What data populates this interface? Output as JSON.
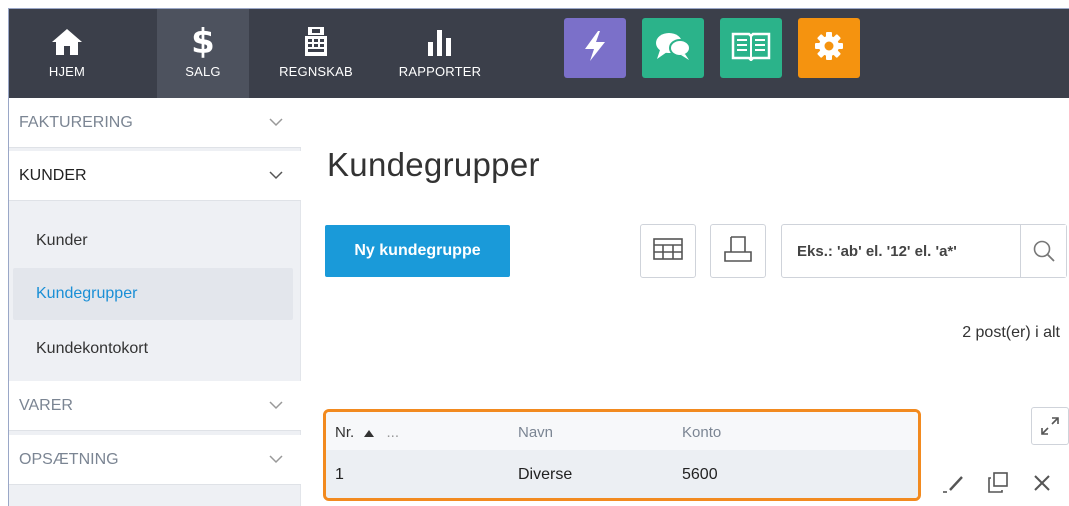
{
  "topnav": {
    "items": [
      {
        "id": "hjem",
        "label": "HJEM",
        "icon": "home-icon"
      },
      {
        "id": "salg",
        "label": "SALG",
        "icon": "dollar-icon",
        "glyph": "$",
        "active": true
      },
      {
        "id": "regnskab",
        "label": "REGNSKAB",
        "icon": "calculator-icon"
      },
      {
        "id": "rapporter",
        "label": "RAPPORTER",
        "icon": "bar-chart-icon"
      }
    ],
    "apps": [
      {
        "id": "lightning",
        "icon": "lightning-icon",
        "color": "#7b70c9"
      },
      {
        "id": "chat",
        "icon": "chat-icon",
        "color": "#2bb38a"
      },
      {
        "id": "book",
        "icon": "book-icon",
        "color": "#2bb38a"
      },
      {
        "id": "settings",
        "icon": "gear-icon",
        "color": "#f5930f"
      }
    ]
  },
  "sidebar": {
    "sections": [
      {
        "label": "FAKTURERING",
        "open": false
      },
      {
        "label": "KUNDER",
        "open": true,
        "items": [
          {
            "label": "Kunder",
            "active": false
          },
          {
            "label": "Kundegrupper",
            "active": true
          },
          {
            "label": "Kundekontokort",
            "active": false
          }
        ]
      },
      {
        "label": "VARER",
        "open": false
      },
      {
        "label": "OPSÆTNING",
        "open": false
      }
    ]
  },
  "main": {
    "title": "Kundegrupper",
    "new_button": "Ny kundegruppe",
    "search_placeholder": "Eks.: 'ab' el. '12' el. 'a*'",
    "record_count": "2 post(er) i alt",
    "table": {
      "columns": [
        {
          "label": "Nr.",
          "sort": "asc",
          "extra": "..."
        },
        {
          "label": "Navn"
        },
        {
          "label": "Konto"
        }
      ],
      "rows": [
        {
          "nr": "1",
          "navn": "Diverse",
          "konto": "5600"
        }
      ]
    }
  },
  "colors": {
    "nav_bg": "#3b3f4a",
    "accent": "#1a9ad9",
    "highlight_border": "#f28a1f"
  }
}
